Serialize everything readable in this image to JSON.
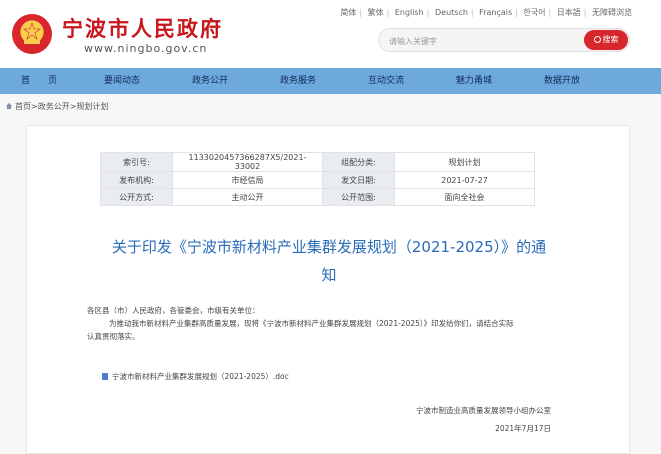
{
  "header": {
    "site_title": "宁波市人民政府",
    "site_url": "www.ningbo.gov.cn",
    "languages": [
      "简体",
      "繁体",
      "English",
      "Deutsch",
      "Français",
      "한국어",
      "日本語",
      "无障碍浏览"
    ],
    "search": {
      "placeholder": "请输入关键字",
      "button_label": "搜索"
    }
  },
  "nav": {
    "items": [
      "首　　页",
      "要闻动态",
      "政务公开",
      "政务服务",
      "互动交流",
      "魅力甬城",
      "数据开放"
    ]
  },
  "breadcrumb": "首页>政务公开>规划计划",
  "meta": {
    "index_label": "索引号:",
    "index_value": "1133020457366287X5/2021-33002",
    "category_label": "组配分类:",
    "category_value": "规划计划",
    "publisher_label": "发布机构:",
    "publisher_value": "市经信局",
    "date_label": "发文日期:",
    "date_value": "2021-07-27",
    "method_label": "公开方式:",
    "method_value": "主动公开",
    "scope_label": "公开范围:",
    "scope_value": "面向全社会"
  },
  "article": {
    "title_line1": "关于印发《宁波市新材料产业集群发展规划（2021-2025）》的通",
    "title_line2": "知",
    "salutation": "各区县（市）人民政府，各管委会，市级有关单位：",
    "body_line1": "为推动我市新材料产业集群高质量发展，现将《宁波市新材料产业集群发展规划（2021-2025）》印发给你们，请结合实际",
    "body_line2": "认真贯彻落实。",
    "attachment": "宁波市新材料产业集群发展规划（2021-2025）.doc",
    "signature_org": "宁波市制造业高质量发展领导小组办公室",
    "signature_date": "2021年7月17日"
  }
}
